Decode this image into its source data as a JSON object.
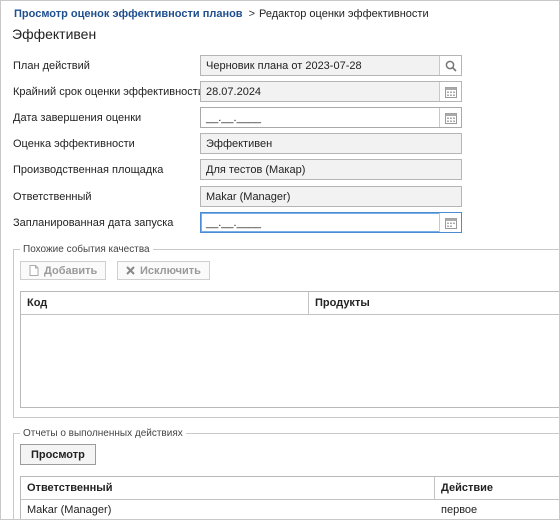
{
  "breadcrumb": {
    "link": "Просмотр оценок эффективности планов",
    "separator": ">",
    "current": "Редактор оценки эффективности"
  },
  "page_title": "Эффективен",
  "form": {
    "action_plan": {
      "label": "План действий",
      "value": "Черновик плана от 2023-07-28"
    },
    "deadline": {
      "label": "Крайний срок оценки эффективности",
      "value": "28.07.2024"
    },
    "completion_date": {
      "label": "Дата завершения оценки",
      "value": "__.__.____"
    },
    "assessment": {
      "label": "Оценка эффективности",
      "value": "Эффективен"
    },
    "site": {
      "label": "Производственная площадка",
      "value": "Для тестов (Макар)"
    },
    "responsible": {
      "label": "Ответственный",
      "value": "Makar (Manager)"
    },
    "planned_start": {
      "label": "Запланированная дата запуска",
      "value": "__.__.____"
    }
  },
  "similar_events": {
    "legend": "Похожие события качества",
    "add_label": "Добавить",
    "exclude_label": "Исключить",
    "columns": [
      "Код",
      "Продукты"
    ]
  },
  "reports": {
    "legend": "Отчеты о выполненных действиях",
    "view_label": "Просмотр",
    "columns": [
      "Ответственный",
      "Действие"
    ],
    "rows": [
      {
        "responsible": "Makar (Manager)",
        "action": "первое"
      }
    ]
  }
}
